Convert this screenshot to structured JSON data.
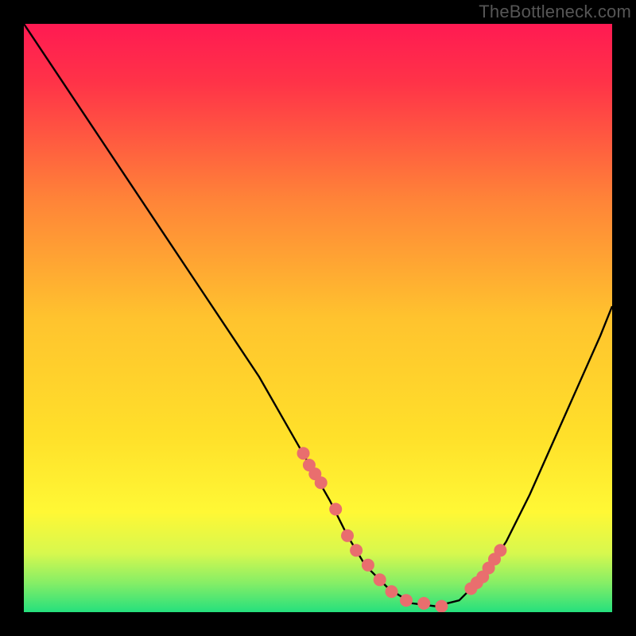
{
  "watermark": "TheBottleneck.com",
  "colors": {
    "gradient_top": "#ff1a52",
    "gradient_mid": "#ffe02a",
    "gradient_bottom": "#25e07d",
    "curve": "#000000",
    "dots": "#e96e6e",
    "frame": "#000000"
  },
  "chart_data": {
    "type": "line",
    "title": "",
    "xlabel": "",
    "ylabel": "",
    "xlim": [
      0,
      100
    ],
    "ylim": [
      0,
      100
    ],
    "curve": {
      "x": [
        0,
        6,
        12,
        18,
        24,
        30,
        36,
        40,
        44,
        48,
        52,
        55,
        58,
        62,
        66,
        70,
        74,
        78,
        82,
        86,
        90,
        94,
        98,
        100
      ],
      "y": [
        100,
        91,
        82,
        73,
        64,
        55,
        46,
        40,
        33,
        26,
        19,
        13,
        8,
        4,
        1.5,
        1,
        2,
        6,
        12,
        20,
        29,
        38,
        47,
        52
      ]
    },
    "dots": {
      "x": [
        47.5,
        48.5,
        49.5,
        50.5,
        53.0,
        55.0,
        56.5,
        58.5,
        60.5,
        62.5,
        65.0,
        68.0,
        71.0,
        76.0,
        77.0,
        78.0,
        79.0,
        80.0,
        81.0
      ],
      "y": [
        27.0,
        25.0,
        23.5,
        22.0,
        17.5,
        13.0,
        10.5,
        8.0,
        5.5,
        3.5,
        2.0,
        1.5,
        1.0,
        4.0,
        5.0,
        6.0,
        7.5,
        9.0,
        10.5
      ]
    }
  }
}
